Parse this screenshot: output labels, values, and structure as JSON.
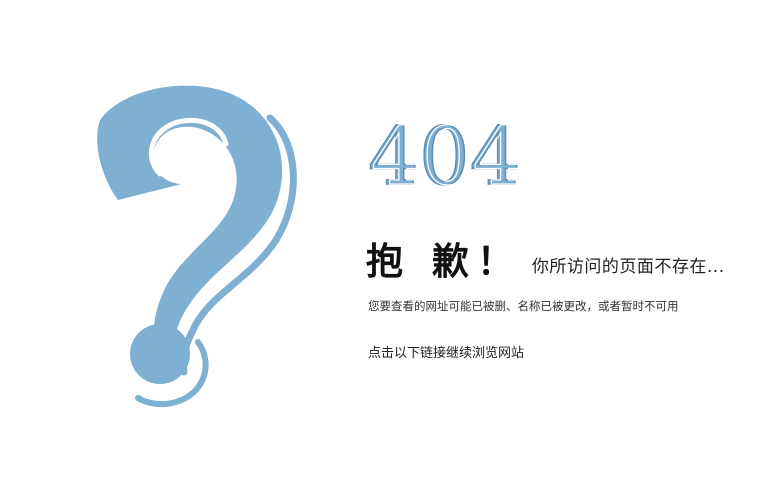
{
  "error": {
    "code": "404",
    "title": "抱 歉！",
    "message": "你所访问的页面不存在...",
    "detail": "您要查看的网址可能已被删、名称已被更改，或者暂时不可用",
    "continue_link": "点击以下链接继续浏览网站"
  },
  "icons": {
    "illustration": "question-mark-icon"
  },
  "colors": {
    "accent": "#7fb0d2",
    "text": "#222222",
    "background": "#ffffff"
  }
}
